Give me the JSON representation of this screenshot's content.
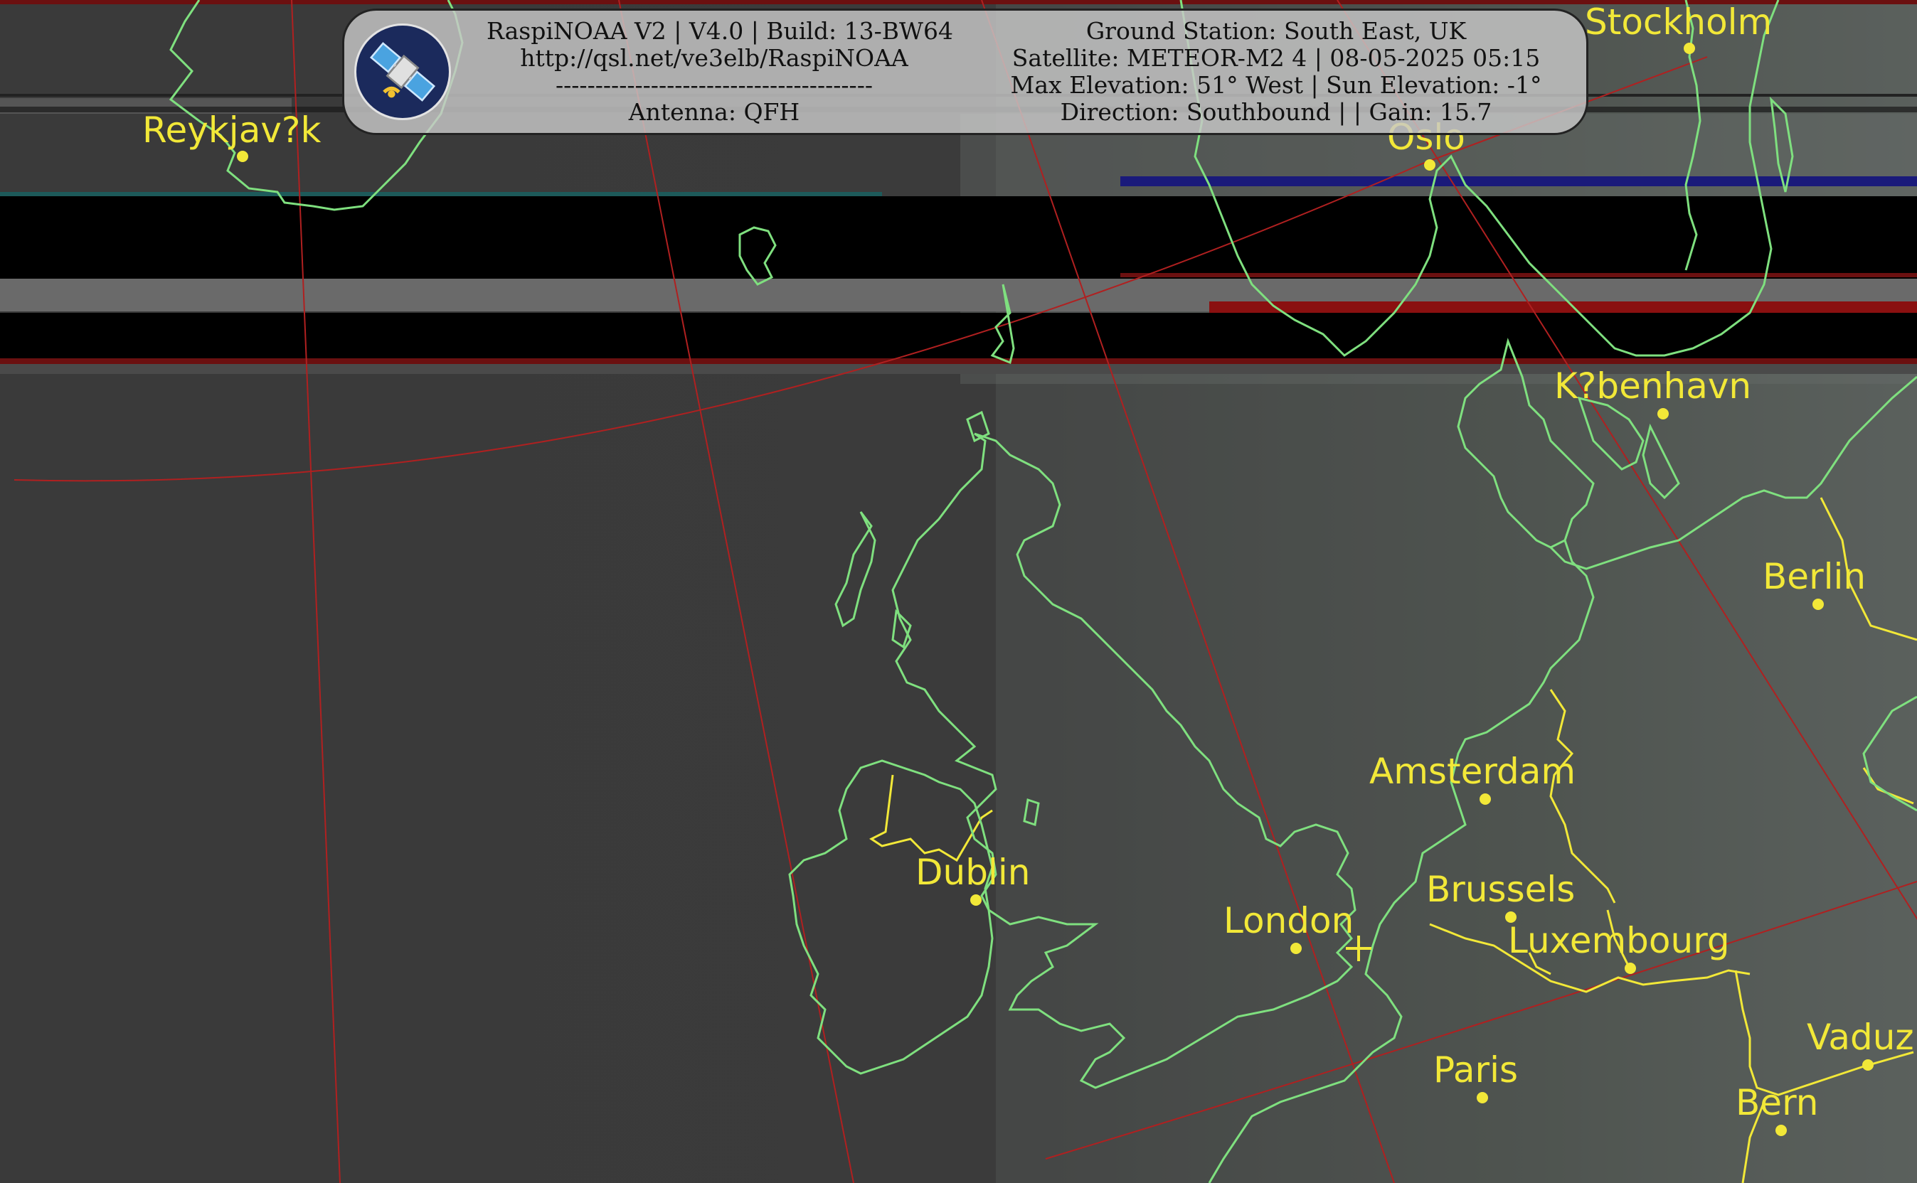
{
  "header": {
    "left_lines": [
      "RaspiNOAA V2 | V4.0 | Build: 13-BW64",
      "http://qsl.net/ve3elb/RaspiNOAA",
      "----------------------------------------",
      "Antenna: QFH"
    ],
    "right_lines": [
      "Ground Station: South East, UK",
      "Satellite: METEOR-M2 4 | 08-05-2025 05:15",
      "Max Elevation: 51° West | Sun Elevation: -1°",
      "Direction: Southbound | | Gain: 15.7"
    ],
    "logo_icon": "satellite-icon"
  },
  "cities": [
    {
      "name": "Reykjav?k"
    },
    {
      "name": "Stockholm"
    },
    {
      "name": "Oslo"
    },
    {
      "name": "K?benhavn"
    },
    {
      "name": "Berlin"
    },
    {
      "name": "Amsterdam"
    },
    {
      "name": "Dublin"
    },
    {
      "name": "London"
    },
    {
      "name": "Brussels"
    },
    {
      "name": "Luxembourg"
    },
    {
      "name": "Paris"
    },
    {
      "name": "Vaduz"
    },
    {
      "name": "Bern"
    }
  ],
  "colors": {
    "coastline": "#7fe07f",
    "border": "#f2e838",
    "grid": "#b02020",
    "labels": "#f2e838",
    "background": "#3a3a3a"
  }
}
